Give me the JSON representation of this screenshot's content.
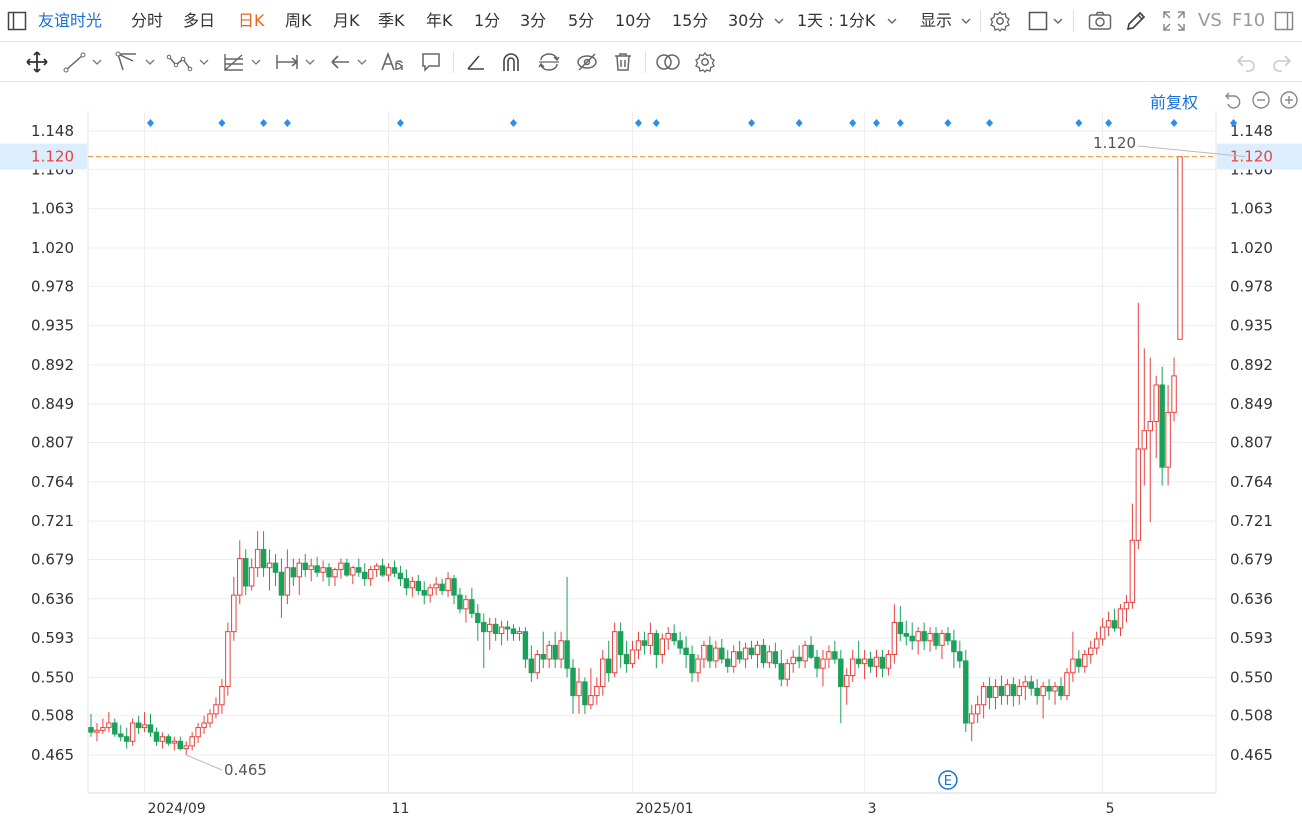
{
  "stock": {
    "name": "友谊时光"
  },
  "periods": [
    "分时",
    "多日",
    "日K",
    "周K",
    "月K",
    "季K",
    "年K",
    "1分",
    "3分",
    "5分",
    "10分",
    "15分",
    "30分"
  ],
  "active_period": "日K",
  "range_selector": "1天 : 1分K",
  "display_label": "显示",
  "vs_label": "VS",
  "f10_label": "F10",
  "adjust_label": "前复权",
  "event_marker_label": "E",
  "colors": {
    "up": "#e8423f",
    "down": "#1aa15a",
    "accent": "#1a6fd6",
    "active": "#e6651a",
    "grid": "#eeeeee",
    "marker": "#2a8ef0"
  },
  "chart_data": {
    "type": "candlestick",
    "y_ticks": [
      "1.148",
      "1.106",
      "1.063",
      "1.020",
      "0.978",
      "0.935",
      "0.892",
      "0.849",
      "0.807",
      "0.764",
      "0.721",
      "0.679",
      "0.636",
      "0.593",
      "0.550",
      "0.508",
      "0.465"
    ],
    "ylim": [
      0.423,
      1.18
    ],
    "x_labels": [
      {
        "label": "2024/09",
        "index": 9
      },
      {
        "label": "11",
        "index": 50
      },
      {
        "label": "2025/01",
        "index": 91
      },
      {
        "label": "3",
        "index": 130
      },
      {
        "label": "5",
        "index": 170
      }
    ],
    "last_price": "1.120",
    "high_label": "1.120",
    "low_label": "0.465",
    "high_index": 194,
    "low_index": 16,
    "marker_indices": [
      10,
      22,
      29,
      33,
      52,
      71,
      92,
      95,
      111,
      119,
      128,
      132,
      136,
      144,
      151,
      166,
      171,
      182,
      192
    ],
    "event_index": 144,
    "ohlc": [
      [
        0.495,
        0.51,
        0.485,
        0.49
      ],
      [
        0.49,
        0.5,
        0.48,
        0.492
      ],
      [
        0.492,
        0.505,
        0.488,
        0.495
      ],
      [
        0.495,
        0.512,
        0.49,
        0.5
      ],
      [
        0.5,
        0.505,
        0.485,
        0.488
      ],
      [
        0.488,
        0.498,
        0.48,
        0.485
      ],
      [
        0.485,
        0.495,
        0.472,
        0.48
      ],
      [
        0.48,
        0.505,
        0.475,
        0.5
      ],
      [
        0.5,
        0.508,
        0.488,
        0.495
      ],
      [
        0.495,
        0.512,
        0.49,
        0.498
      ],
      [
        0.498,
        0.51,
        0.485,
        0.49
      ],
      [
        0.49,
        0.495,
        0.475,
        0.48
      ],
      [
        0.48,
        0.49,
        0.472,
        0.485
      ],
      [
        0.485,
        0.488,
        0.475,
        0.478
      ],
      [
        0.478,
        0.485,
        0.47,
        0.48
      ],
      [
        0.48,
        0.485,
        0.47,
        0.472
      ],
      [
        0.472,
        0.48,
        0.465,
        0.475
      ],
      [
        0.475,
        0.49,
        0.47,
        0.485
      ],
      [
        0.485,
        0.5,
        0.478,
        0.495
      ],
      [
        0.495,
        0.508,
        0.488,
        0.5
      ],
      [
        0.5,
        0.515,
        0.495,
        0.51
      ],
      [
        0.51,
        0.528,
        0.505,
        0.52
      ],
      [
        0.52,
        0.548,
        0.51,
        0.54
      ],
      [
        0.54,
        0.61,
        0.53,
        0.6
      ],
      [
        0.6,
        0.66,
        0.59,
        0.64
      ],
      [
        0.64,
        0.7,
        0.63,
        0.68
      ],
      [
        0.68,
        0.69,
        0.64,
        0.65
      ],
      [
        0.65,
        0.68,
        0.645,
        0.67
      ],
      [
        0.67,
        0.71,
        0.66,
        0.69
      ],
      [
        0.69,
        0.71,
        0.66,
        0.67
      ],
      [
        0.67,
        0.69,
        0.645,
        0.675
      ],
      [
        0.675,
        0.685,
        0.65,
        0.665
      ],
      [
        0.665,
        0.68,
        0.615,
        0.64
      ],
      [
        0.64,
        0.69,
        0.63,
        0.67
      ],
      [
        0.67,
        0.68,
        0.65,
        0.66
      ],
      [
        0.66,
        0.68,
        0.64,
        0.675
      ],
      [
        0.675,
        0.685,
        0.66,
        0.668
      ],
      [
        0.668,
        0.68,
        0.655,
        0.672
      ],
      [
        0.672,
        0.682,
        0.66,
        0.665
      ],
      [
        0.665,
        0.678,
        0.655,
        0.67
      ],
      [
        0.67,
        0.675,
        0.65,
        0.66
      ],
      [
        0.66,
        0.67,
        0.65,
        0.668
      ],
      [
        0.668,
        0.68,
        0.658,
        0.675
      ],
      [
        0.675,
        0.68,
        0.66,
        0.662
      ],
      [
        0.662,
        0.672,
        0.652,
        0.67
      ],
      [
        0.67,
        0.68,
        0.66,
        0.665
      ],
      [
        0.665,
        0.675,
        0.65,
        0.658
      ],
      [
        0.658,
        0.672,
        0.65,
        0.668
      ],
      [
        0.668,
        0.675,
        0.66,
        0.672
      ],
      [
        0.672,
        0.68,
        0.66,
        0.662
      ],
      [
        0.662,
        0.675,
        0.655,
        0.67
      ],
      [
        0.67,
        0.678,
        0.66,
        0.664
      ],
      [
        0.664,
        0.672,
        0.65,
        0.658
      ],
      [
        0.658,
        0.668,
        0.64,
        0.648
      ],
      [
        0.648,
        0.66,
        0.638,
        0.655
      ],
      [
        0.655,
        0.662,
        0.64,
        0.645
      ],
      [
        0.645,
        0.655,
        0.63,
        0.64
      ],
      [
        0.64,
        0.652,
        0.632,
        0.648
      ],
      [
        0.648,
        0.66,
        0.64,
        0.652
      ],
      [
        0.652,
        0.658,
        0.64,
        0.645
      ],
      [
        0.645,
        0.665,
        0.638,
        0.658
      ],
      [
        0.658,
        0.662,
        0.63,
        0.64
      ],
      [
        0.64,
        0.648,
        0.62,
        0.625
      ],
      [
        0.625,
        0.64,
        0.61,
        0.635
      ],
      [
        0.635,
        0.648,
        0.615,
        0.62
      ],
      [
        0.62,
        0.63,
        0.59,
        0.61
      ],
      [
        0.61,
        0.62,
        0.56,
        0.6
      ],
      [
        0.6,
        0.615,
        0.58,
        0.608
      ],
      [
        0.608,
        0.615,
        0.59,
        0.598
      ],
      [
        0.598,
        0.612,
        0.585,
        0.605
      ],
      [
        0.605,
        0.612,
        0.59,
        0.603
      ],
      [
        0.603,
        0.608,
        0.59,
        0.598
      ],
      [
        0.598,
        0.605,
        0.59,
        0.6
      ],
      [
        0.6,
        0.605,
        0.56,
        0.57
      ],
      [
        0.57,
        0.585,
        0.545,
        0.555
      ],
      [
        0.555,
        0.58,
        0.548,
        0.575
      ],
      [
        0.575,
        0.6,
        0.56,
        0.57
      ],
      [
        0.57,
        0.59,
        0.56,
        0.585
      ],
      [
        0.585,
        0.6,
        0.56,
        0.57
      ],
      [
        0.57,
        0.6,
        0.56,
        0.59
      ],
      [
        0.59,
        0.66,
        0.55,
        0.56
      ],
      [
        0.56,
        0.57,
        0.51,
        0.53
      ],
      [
        0.53,
        0.56,
        0.51,
        0.545
      ],
      [
        0.545,
        0.55,
        0.51,
        0.52
      ],
      [
        0.52,
        0.56,
        0.515,
        0.53
      ],
      [
        0.53,
        0.55,
        0.52,
        0.54
      ],
      [
        0.54,
        0.58,
        0.53,
        0.57
      ],
      [
        0.57,
        0.59,
        0.545,
        0.555
      ],
      [
        0.555,
        0.61,
        0.55,
        0.6
      ],
      [
        0.6,
        0.61,
        0.56,
        0.575
      ],
      [
        0.575,
        0.59,
        0.555,
        0.565
      ],
      [
        0.565,
        0.59,
        0.56,
        0.58
      ],
      [
        0.58,
        0.6,
        0.57,
        0.59
      ],
      [
        0.59,
        0.6,
        0.575,
        0.585
      ],
      [
        0.585,
        0.61,
        0.575,
        0.598
      ],
      [
        0.598,
        0.602,
        0.56,
        0.575
      ],
      [
        0.575,
        0.598,
        0.565,
        0.592
      ],
      [
        0.592,
        0.605,
        0.58,
        0.598
      ],
      [
        0.598,
        0.608,
        0.585,
        0.59
      ],
      [
        0.59,
        0.6,
        0.575,
        0.582
      ],
      [
        0.582,
        0.595,
        0.56,
        0.575
      ],
      [
        0.575,
        0.585,
        0.545,
        0.555
      ],
      [
        0.555,
        0.575,
        0.545,
        0.57
      ],
      [
        0.57,
        0.59,
        0.56,
        0.585
      ],
      [
        0.585,
        0.595,
        0.56,
        0.568
      ],
      [
        0.568,
        0.59,
        0.56,
        0.582
      ],
      [
        0.582,
        0.592,
        0.565,
        0.57
      ],
      [
        0.57,
        0.58,
        0.555,
        0.562
      ],
      [
        0.562,
        0.585,
        0.555,
        0.578
      ],
      [
        0.578,
        0.59,
        0.565,
        0.57
      ],
      [
        0.57,
        0.588,
        0.56,
        0.582
      ],
      [
        0.582,
        0.59,
        0.57,
        0.575
      ],
      [
        0.575,
        0.59,
        0.56,
        0.585
      ],
      [
        0.585,
        0.592,
        0.56,
        0.566
      ],
      [
        0.566,
        0.585,
        0.56,
        0.578
      ],
      [
        0.578,
        0.588,
        0.56,
        0.565
      ],
      [
        0.565,
        0.58,
        0.54,
        0.548
      ],
      [
        0.548,
        0.57,
        0.54,
        0.565
      ],
      [
        0.565,
        0.58,
        0.555,
        0.572
      ],
      [
        0.572,
        0.585,
        0.56,
        0.568
      ],
      [
        0.568,
        0.59,
        0.56,
        0.585
      ],
      [
        0.585,
        0.595,
        0.57,
        0.572
      ],
      [
        0.572,
        0.58,
        0.55,
        0.56
      ],
      [
        0.56,
        0.58,
        0.54,
        0.57
      ],
      [
        0.57,
        0.585,
        0.56,
        0.578
      ],
      [
        0.578,
        0.59,
        0.565,
        0.57
      ],
      [
        0.57,
        0.58,
        0.5,
        0.54
      ],
      [
        0.54,
        0.56,
        0.52,
        0.552
      ],
      [
        0.552,
        0.58,
        0.545,
        0.57
      ],
      [
        0.57,
        0.59,
        0.56,
        0.565
      ],
      [
        0.565,
        0.58,
        0.548,
        0.57
      ],
      [
        0.57,
        0.578,
        0.555,
        0.562
      ],
      [
        0.562,
        0.58,
        0.55,
        0.572
      ],
      [
        0.572,
        0.58,
        0.55,
        0.56
      ],
      [
        0.56,
        0.58,
        0.552,
        0.575
      ],
      [
        0.575,
        0.63,
        0.565,
        0.61
      ],
      [
        0.61,
        0.628,
        0.59,
        0.598
      ],
      [
        0.598,
        0.612,
        0.585,
        0.595
      ],
      [
        0.595,
        0.61,
        0.58,
        0.59
      ],
      [
        0.59,
        0.605,
        0.575,
        0.6
      ],
      [
        0.6,
        0.61,
        0.58,
        0.59
      ],
      [
        0.59,
        0.605,
        0.578,
        0.598
      ],
      [
        0.598,
        0.605,
        0.58,
        0.585
      ],
      [
        0.585,
        0.602,
        0.57,
        0.598
      ],
      [
        0.598,
        0.605,
        0.585,
        0.59
      ],
      [
        0.59,
        0.602,
        0.56,
        0.578
      ],
      [
        0.578,
        0.59,
        0.56,
        0.568
      ],
      [
        0.568,
        0.58,
        0.49,
        0.5
      ],
      [
        0.5,
        0.52,
        0.48,
        0.51
      ],
      [
        0.51,
        0.53,
        0.5,
        0.52
      ],
      [
        0.52,
        0.545,
        0.505,
        0.54
      ],
      [
        0.54,
        0.55,
        0.515,
        0.528
      ],
      [
        0.528,
        0.548,
        0.515,
        0.54
      ],
      [
        0.54,
        0.552,
        0.52,
        0.53
      ],
      [
        0.53,
        0.548,
        0.52,
        0.542
      ],
      [
        0.542,
        0.55,
        0.518,
        0.53
      ],
      [
        0.53,
        0.548,
        0.52,
        0.54
      ],
      [
        0.54,
        0.552,
        0.525,
        0.545
      ],
      [
        0.545,
        0.552,
        0.53,
        0.538
      ],
      [
        0.538,
        0.548,
        0.52,
        0.53
      ],
      [
        0.53,
        0.545,
        0.505,
        0.54
      ],
      [
        0.54,
        0.548,
        0.525,
        0.535
      ],
      [
        0.535,
        0.545,
        0.52,
        0.54
      ],
      [
        0.54,
        0.55,
        0.525,
        0.53
      ],
      [
        0.53,
        0.56,
        0.525,
        0.555
      ],
      [
        0.555,
        0.6,
        0.545,
        0.57
      ],
      [
        0.57,
        0.58,
        0.555,
        0.562
      ],
      [
        0.562,
        0.58,
        0.555,
        0.575
      ],
      [
        0.575,
        0.59,
        0.565,
        0.582
      ],
      [
        0.582,
        0.6,
        0.575,
        0.592
      ],
      [
        0.592,
        0.615,
        0.585,
        0.605
      ],
      [
        0.605,
        0.622,
        0.595,
        0.612
      ],
      [
        0.612,
        0.625,
        0.6,
        0.604
      ],
      [
        0.604,
        0.63,
        0.595,
        0.625
      ],
      [
        0.625,
        0.64,
        0.61,
        0.632
      ],
      [
        0.632,
        0.74,
        0.625,
        0.7
      ],
      [
        0.7,
        0.96,
        0.69,
        0.8
      ],
      [
        0.8,
        0.91,
        0.76,
        0.82
      ],
      [
        0.82,
        0.9,
        0.72,
        0.83
      ],
      [
        0.83,
        0.88,
        0.79,
        0.87
      ],
      [
        0.87,
        0.89,
        0.76,
        0.78
      ],
      [
        0.78,
        0.87,
        0.76,
        0.84
      ],
      [
        0.84,
        0.9,
        0.83,
        0.88
      ],
      [
        0.92,
        1.12,
        0.92,
        1.12
      ]
    ]
  }
}
